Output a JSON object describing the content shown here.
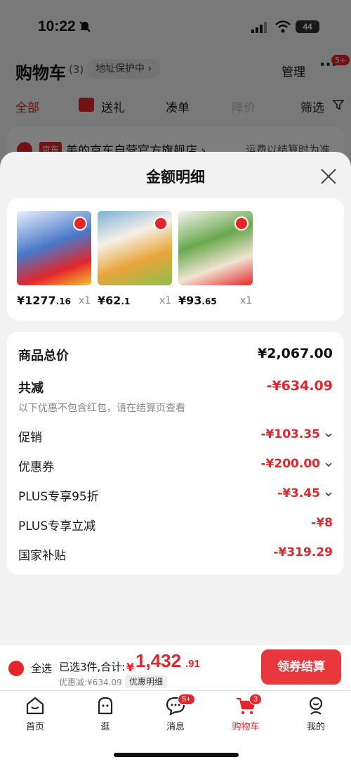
{
  "status_bar": {
    "time": "10:22",
    "battery": "44"
  },
  "cart_header": {
    "title": "购物车",
    "count": "(3)",
    "address_label": "地址保护中 ›",
    "manage": "管理",
    "more_badge": "5+"
  },
  "filters": [
    {
      "label": "全部"
    },
    {
      "label": "送礼"
    },
    {
      "label": "凑单"
    },
    {
      "label": "降价"
    },
    {
      "label": "筛选"
    }
  ],
  "store": {
    "tag": "京东",
    "name": "美的京东自营官方旗舰店 ›",
    "shipping": "运费以结算时为准"
  },
  "sheet": {
    "title": "金额明细",
    "products": [
      {
        "price_main": "¥1277",
        "price_cents": ".16",
        "qty": "x1",
        "img_color": "#4a78c8"
      },
      {
        "price_main": "¥62",
        "price_cents": ".1",
        "qty": "x1",
        "img_color": "#8fbf4f"
      },
      {
        "price_main": "¥93",
        "price_cents": ".65",
        "qty": "x1",
        "img_color": "#6aa84f"
      }
    ],
    "summary": {
      "total_label": "商品总价",
      "total_value": "¥2,067.00",
      "reduce_label": "共减",
      "reduce_value": "-¥634.09",
      "note": "以下优惠不包含红包，请在结算页查看",
      "items": [
        {
          "label": "促销",
          "value": "-¥103.35",
          "expandable": true
        },
        {
          "label": "优惠券",
          "value": "-¥200.00",
          "expandable": true
        },
        {
          "label": "PLUS专享95折",
          "value": "-¥3.45",
          "expandable": true
        },
        {
          "label": "PLUS专享立减",
          "value": "-¥8",
          "expandable": false
        },
        {
          "label": "国家补贴",
          "value": "-¥319.29",
          "expandable": false
        }
      ]
    }
  },
  "checkout": {
    "select_all": "全选",
    "selected_text": "已选3件,合计:",
    "yen": "¥",
    "total_main": "1,432",
    "total_cents": ".91",
    "discount_text": "优惠减:¥634.09",
    "detail_label": "优惠明细",
    "button": "领券结算"
  },
  "tabbar": [
    {
      "label": "首页",
      "icon": "home-icon"
    },
    {
      "label": "逛",
      "icon": "browse-icon"
    },
    {
      "label": "消息",
      "icon": "message-icon",
      "badge": "5+"
    },
    {
      "label": "购物车",
      "icon": "cart-icon",
      "badge": "3",
      "active": true
    },
    {
      "label": "我的",
      "icon": "profile-icon"
    }
  ],
  "colors": {
    "accent": "#e3262b",
    "button": "#e8373d"
  }
}
